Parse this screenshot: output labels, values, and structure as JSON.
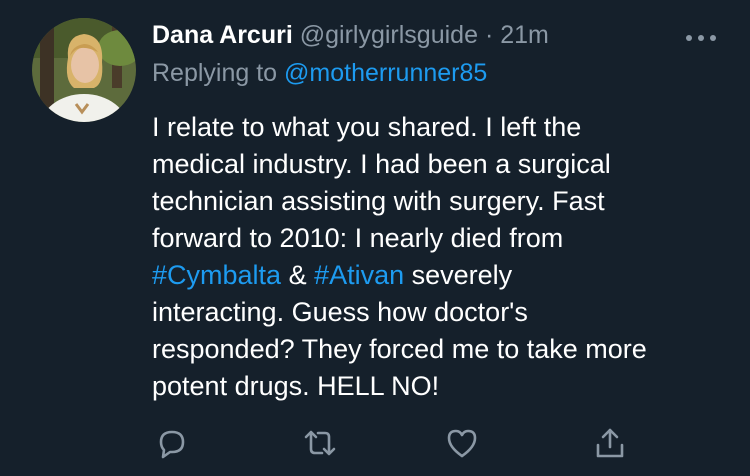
{
  "tweet": {
    "author_name": "Dana Arcuri",
    "author_handle": "@girlygirlsguide",
    "separator": "·",
    "time": "21m",
    "replying_prefix": "Replying to",
    "replying_to": "@motherrunner85",
    "body": {
      "line1": "I relate to what you shared. I left the",
      "line2": "medical industry. I had been a surgical",
      "line3": "technician assisting with surgery. Fast",
      "line4": "forward to 2010: I nearly died from",
      "hashtag1": "#Cymbalta",
      "amp": " & ",
      "hashtag2": "#Ativan",
      "line5_rest": " severely",
      "line6": "interacting. Guess how doctor's",
      "line7": "responded? They forced me to take more",
      "line8": "potent drugs. HELL NO!"
    }
  },
  "icons": {
    "avatar": "avatar-photo",
    "more": "more-horizontal-icon",
    "reply": "reply-icon",
    "retweet": "retweet-icon",
    "like": "like-icon",
    "share": "share-icon"
  },
  "colors": {
    "background": "#15202b",
    "text": "#ffffff",
    "secondary": "#8b98a5",
    "link": "#1d9bf0"
  }
}
